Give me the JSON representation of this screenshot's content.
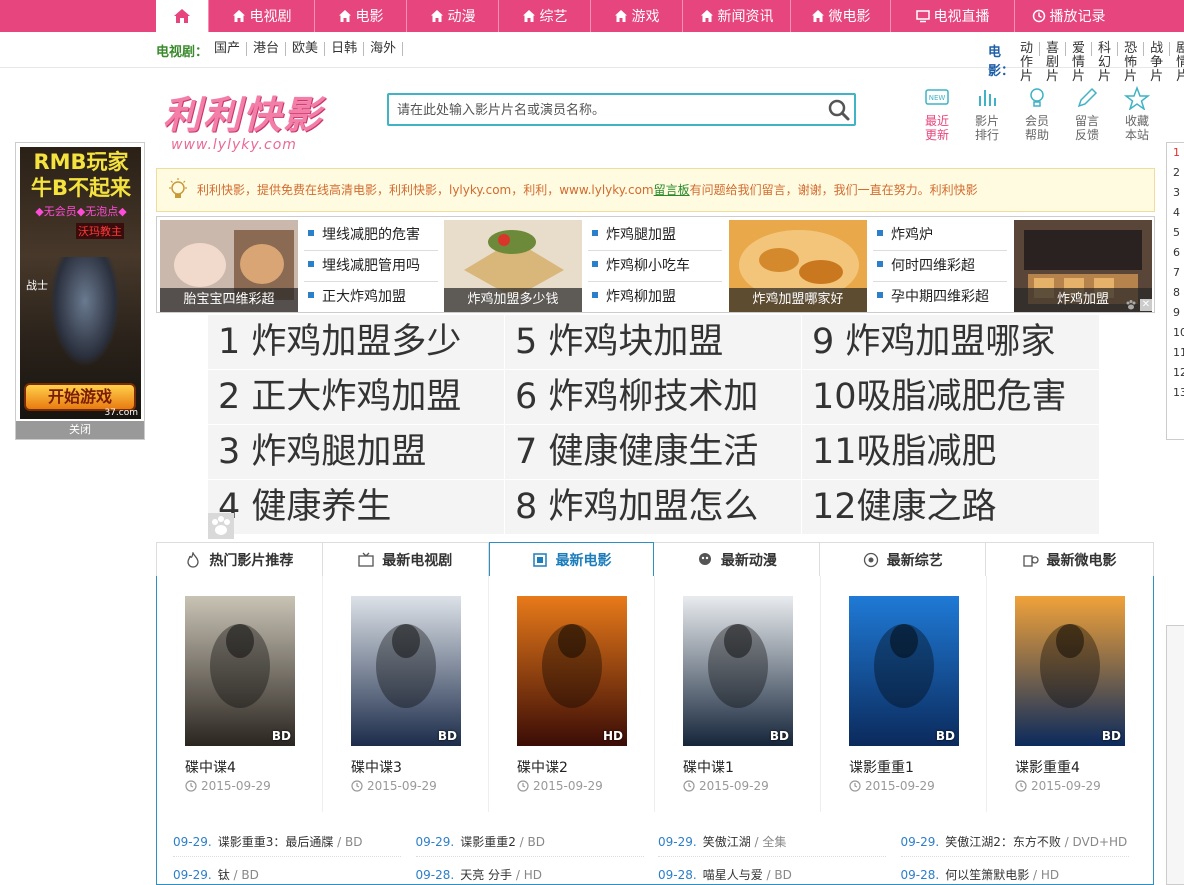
{
  "topnav": {
    "items": [
      "电视剧",
      "电影",
      "动漫",
      "综艺",
      "游戏",
      "新闻资讯",
      "微电影",
      "电视直播",
      "播放记录"
    ]
  },
  "subnav": {
    "tv_label": "电视剧：",
    "tv_items": [
      "国产",
      "港台",
      "欧美",
      "日韩",
      "海外"
    ],
    "movie_label": "电影：",
    "movie_items": [
      "动作片",
      "喜剧片",
      "爱情片",
      "科幻片",
      "恐怖片",
      "战争片",
      "剧情片"
    ]
  },
  "logo": {
    "title": "利利快影",
    "url": "www.lylyky.com"
  },
  "search": {
    "placeholder": "请在此处输入影片片名或演员名称。"
  },
  "quick": [
    {
      "l1": "最近",
      "l2": "更新",
      "icon": "new-icon"
    },
    {
      "l1": "影片",
      "l2": "排行",
      "icon": "bar-chart-icon"
    },
    {
      "l1": "会员",
      "l2": "帮助",
      "icon": "bulb-icon"
    },
    {
      "l1": "留言",
      "l2": "反馈",
      "icon": "pencil-icon"
    },
    {
      "l1": "收藏",
      "l2": "本站",
      "icon": "star-icon"
    }
  ],
  "leftad": {
    "line1": "RMB玩家",
    "line2": "牛B不起来",
    "line3": "◆无会员◆无泡点◆",
    "line4": "沃玛教主",
    "line5": "战士",
    "button": "开始游戏",
    "site": "37.com",
    "close": "关闭"
  },
  "rightedge": [
    "1",
    "2",
    "3",
    "4",
    "5",
    "6",
    "7",
    "8",
    "9",
    "10",
    "11",
    "12",
    "13"
  ],
  "notice": {
    "text1": "利利快影，提供免费在线高清电影，利利快影，lylyky.com，利利，www.lylyky.com",
    "link": "留言板",
    "text2": "有问题给我们留言，谢谢，我们一直在努力。利利快影"
  },
  "adrow": {
    "cells": [
      "胎宝宝四维彩超",
      "炸鸡加盟多少钱",
      "炸鸡加盟哪家好",
      "炸鸡加盟"
    ],
    "lists": [
      [
        "埋线减肥的危害",
        "埋线减肥管用吗",
        "正大炸鸡加盟"
      ],
      [
        "炸鸡腿加盟",
        "炸鸡柳小吃车",
        "炸鸡柳加盟"
      ],
      [
        "炸鸡炉",
        "何时四维彩超",
        "孕中期四维彩超"
      ]
    ],
    "close": "✕"
  },
  "keywords": [
    "1 炸鸡加盟多少",
    "5 炸鸡块加盟",
    "9 炸鸡加盟哪家",
    "2 正大炸鸡加盟",
    "6 炸鸡柳技术加",
    "10吸脂减肥危害",
    "3 炸鸡腿加盟",
    "7 健康健康生活",
    "11吸脂减肥",
    "4 健康养生",
    "8 炸鸡加盟怎么",
    "12健康之路"
  ],
  "tabs": [
    {
      "label": "热门影片推荐",
      "icon": "fire-icon",
      "active": false
    },
    {
      "label": "最新电视剧",
      "icon": "tv-icon",
      "active": false
    },
    {
      "label": "最新电影",
      "icon": "film-icon",
      "active": true
    },
    {
      "label": "最新动漫",
      "icon": "anime-icon",
      "active": false
    },
    {
      "label": "最新综艺",
      "icon": "variety-icon",
      "active": false
    },
    {
      "label": "最新微电影",
      "icon": "camera-icon",
      "active": false
    }
  ],
  "movies": [
    {
      "title": "碟中谍4",
      "date": "2015-09-29",
      "quality": "BD",
      "colors": [
        "#c9c3b6",
        "#2a2520"
      ]
    },
    {
      "title": "碟中谍3",
      "date": "2015-09-29",
      "quality": "BD",
      "colors": [
        "#dde2e8",
        "#1c2c4a"
      ]
    },
    {
      "title": "碟中谍2",
      "date": "2015-09-29",
      "quality": "HD",
      "colors": [
        "#e87a1a",
        "#3a0c06"
      ]
    },
    {
      "title": "碟中谍1",
      "date": "2015-09-29",
      "quality": "BD",
      "colors": [
        "#e9ecef",
        "#15253a"
      ]
    },
    {
      "title": "谍影重重1",
      "date": "2015-09-29",
      "quality": "BD",
      "colors": [
        "#1f7ad6",
        "#0b2a5c"
      ]
    },
    {
      "title": "谍影重重4",
      "date": "2015-09-29",
      "quality": "BD",
      "colors": [
        "#f0a23a",
        "#0b2a5c"
      ]
    }
  ],
  "movielist": [
    [
      {
        "date": "09-29.",
        "name": "谍影重重3：最后通牒",
        "q": "BD"
      },
      {
        "date": "09-29.",
        "name": "谍影重重2",
        "q": "BD"
      },
      {
        "date": "09-29.",
        "name": "笑傲江湖",
        "q": "全集"
      },
      {
        "date": "09-29.",
        "name": "笑傲江湖2：东方不败",
        "q": "DVD+HD"
      }
    ],
    [
      {
        "date": "09-29.",
        "name": "钛",
        "q": "BD"
      },
      {
        "date": "09-28.",
        "name": "天亮 分手",
        "q": "HD"
      },
      {
        "date": "09-28.",
        "name": "喵星人与爱",
        "q": "BD"
      },
      {
        "date": "09-28.",
        "name": "何以笙箫默电影",
        "q": "HD"
      }
    ]
  ]
}
